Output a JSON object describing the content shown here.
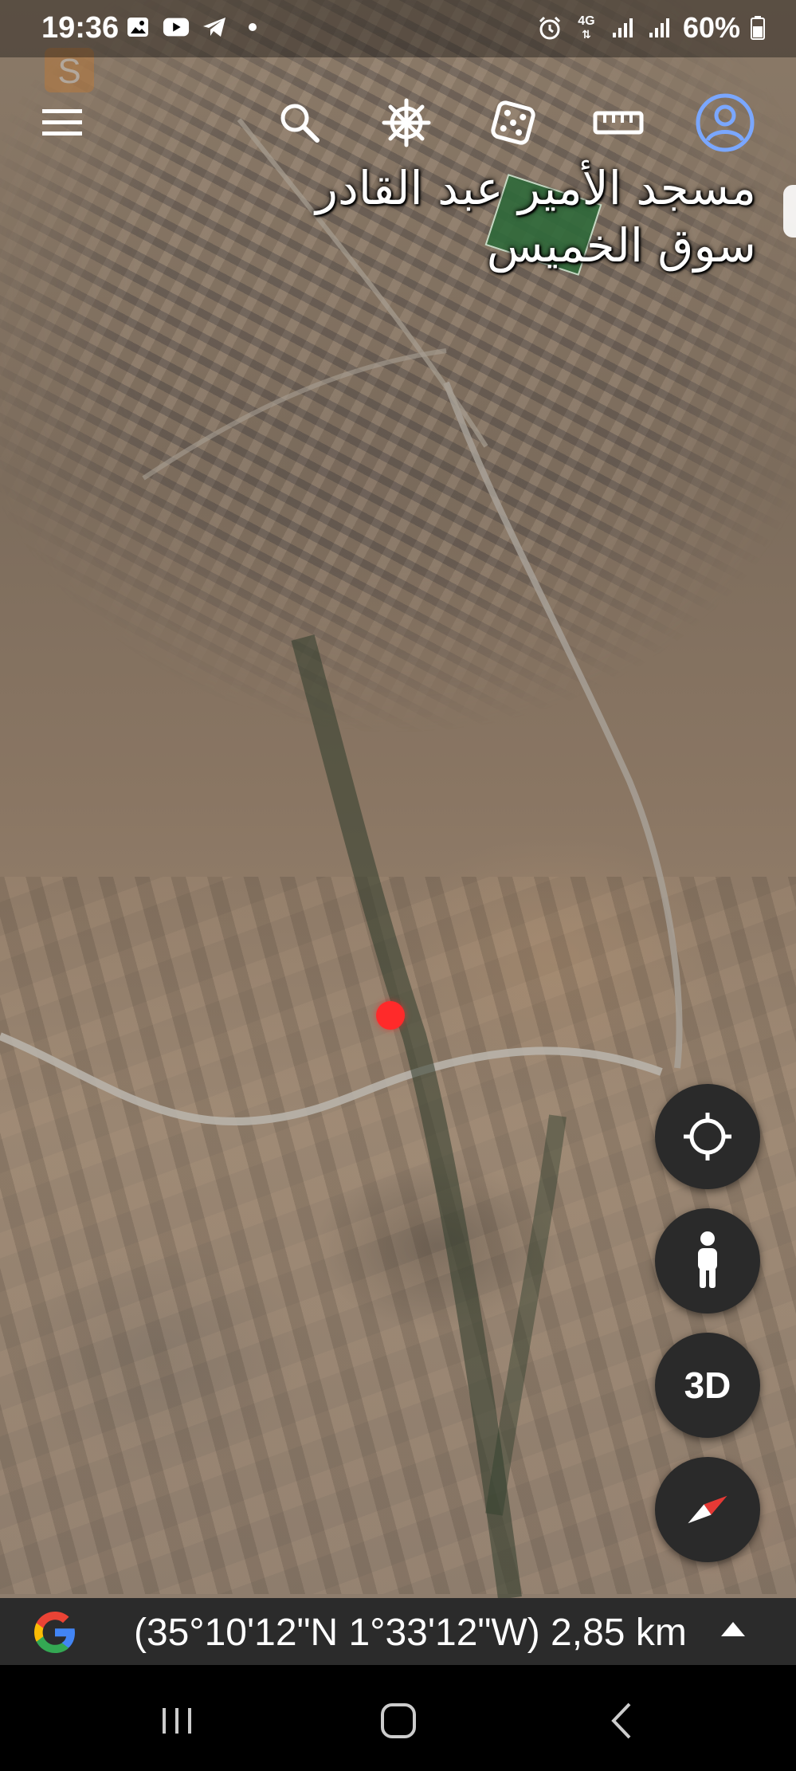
{
  "status_bar": {
    "time": "19:36",
    "battery": "60%",
    "network": "4G",
    "left_icons": [
      "gallery-icon",
      "youtube-icon",
      "telegram-icon",
      "dot-icon"
    ],
    "right_icons": [
      "alarm-icon",
      "data-arrows-icon",
      "signal-icon",
      "signal-icon",
      "battery-icon"
    ]
  },
  "toolbar": {
    "icons": [
      "menu-icon",
      "search-icon",
      "voyager-wheel-icon",
      "dice-icon",
      "ruler-icon",
      "account-icon"
    ]
  },
  "map": {
    "place_label": "مسجد الأمير عبد القادر سوق الخميس",
    "pin_color": "#ff2a2a"
  },
  "floating_buttons": {
    "locate_icon": "crosshair-icon",
    "pegman_icon": "pegman-icon",
    "three_d_label": "3D",
    "compass_icon": "compass-icon"
  },
  "info_bar": {
    "logo": "google-g-icon",
    "coordinates": "(35°10'12\"N 1°33'12\"W) 2,85 km"
  },
  "nav_bar": {
    "icons": [
      "recents-icon",
      "home-icon",
      "back-icon"
    ]
  },
  "colors": {
    "accent_account": "#7aa7ff",
    "fab_bg": "#2a2a2a",
    "info_bar_bg": "#2b2b2b",
    "compass_red": "#e53935"
  }
}
